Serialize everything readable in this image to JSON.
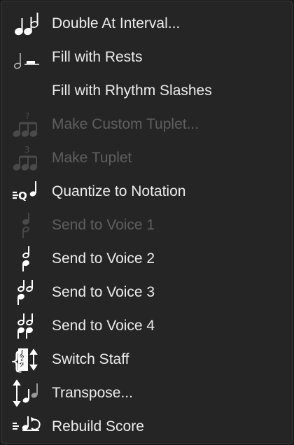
{
  "menu": {
    "items": [
      {
        "label": "Double At Interval...",
        "icon": "double-notes-icon",
        "enabled": true
      },
      {
        "label": "Fill with Rests",
        "icon": "note-rest-icon",
        "enabled": true
      },
      {
        "label": "Fill with Rhythm Slashes",
        "icon": "none",
        "enabled": true
      },
      {
        "label": "Make Custom Tuplet...",
        "icon": "custom-tuplet-icon",
        "enabled": false
      },
      {
        "label": "Make Tuplet",
        "icon": "tuplet-icon",
        "enabled": false
      },
      {
        "label": "Quantize to Notation",
        "icon": "quantize-icon",
        "enabled": true
      },
      {
        "label": "Send to Voice 1",
        "icon": "voice-1-icon",
        "enabled": false
      },
      {
        "label": "Send to Voice 2",
        "icon": "voice-2-icon",
        "enabled": true
      },
      {
        "label": "Send to Voice 3",
        "icon": "voice-3-icon",
        "enabled": true
      },
      {
        "label": "Send to Voice 4",
        "icon": "voice-4-icon",
        "enabled": true
      },
      {
        "label": "Switch Staff",
        "icon": "switch-staff-icon",
        "enabled": true
      },
      {
        "label": "Transpose...",
        "icon": "transpose-icon",
        "enabled": true
      },
      {
        "label": "Rebuild Score",
        "icon": "rebuild-score-icon",
        "enabled": true
      }
    ]
  },
  "colors": {
    "background": "#252525",
    "text": "#ececec",
    "disabled_text": "#5f5f5f",
    "icon": "#ffffff",
    "icon_disabled": "#4a4a4a"
  }
}
